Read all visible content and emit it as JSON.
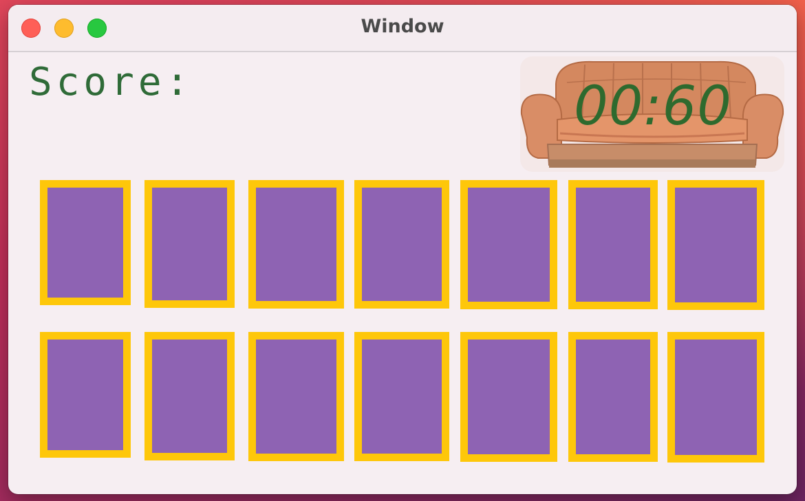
{
  "window": {
    "title": "Window"
  },
  "game": {
    "score_label": "Score:",
    "timer": "00:60",
    "card_face_color": "#8e63b3",
    "card_border_color": "#fec70a",
    "text_color": "#2f6b38",
    "rows": 2,
    "columns": 7,
    "background_image": "couch"
  }
}
